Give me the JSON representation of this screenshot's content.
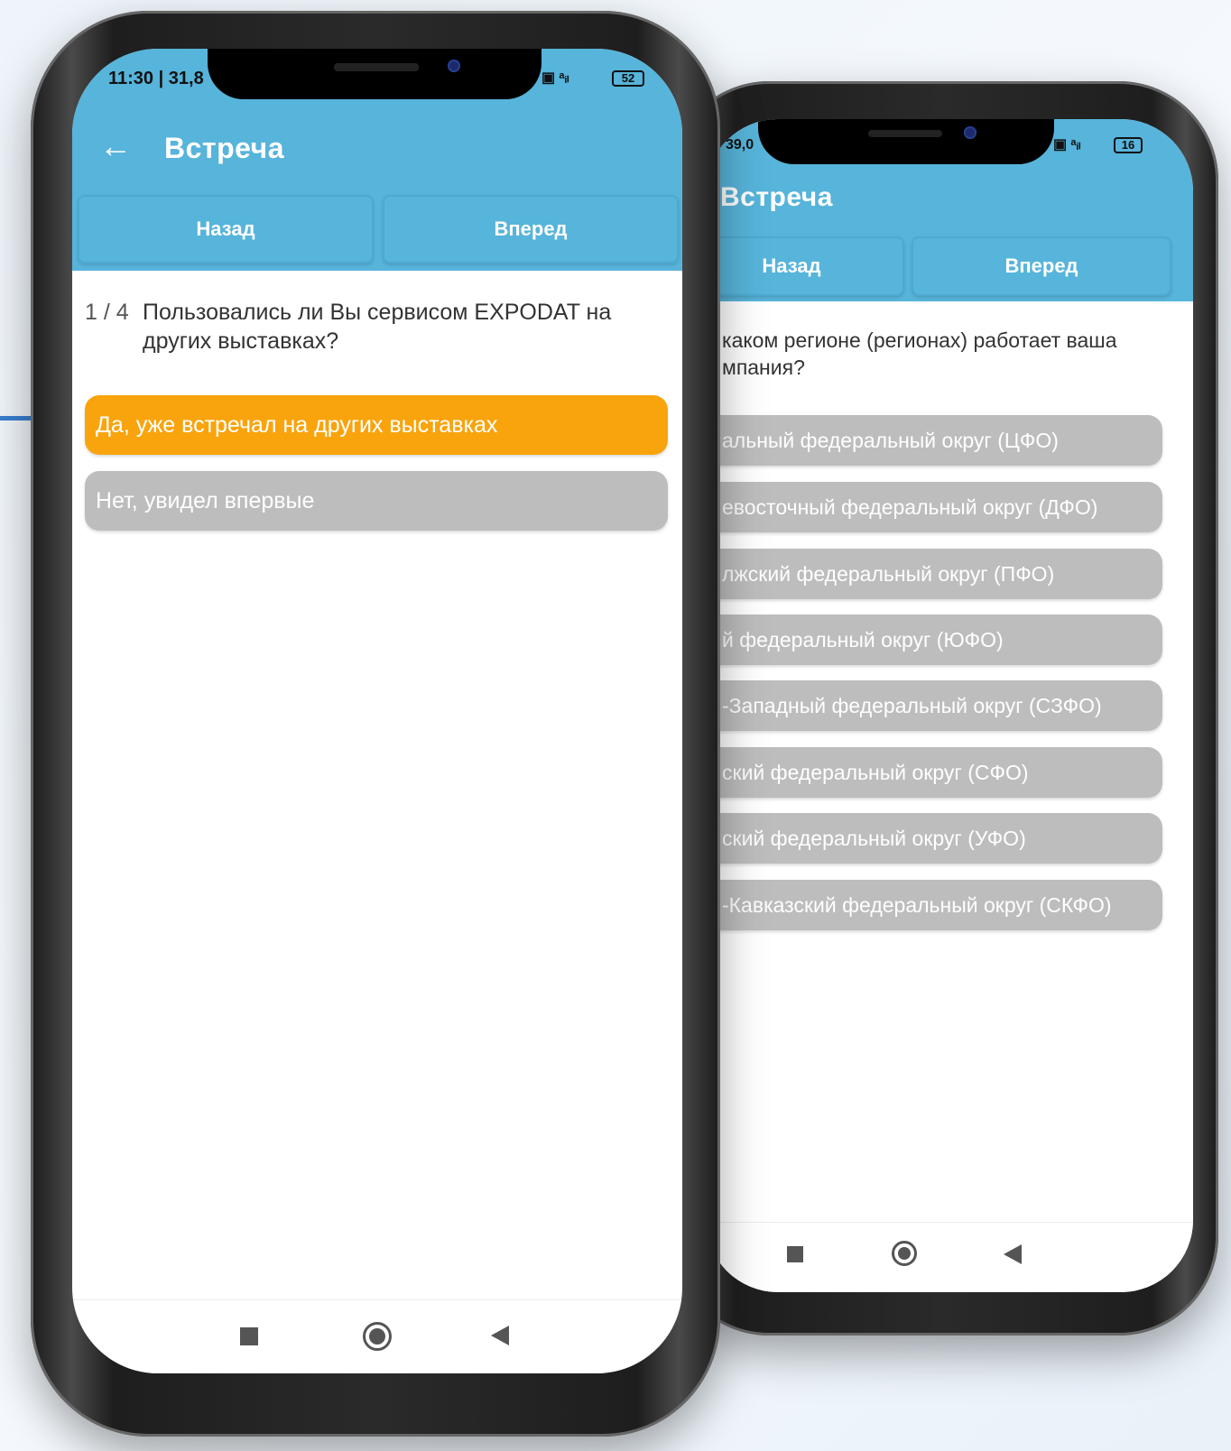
{
  "phone_left": {
    "status": {
      "time": "11:30",
      "speed": "31,8",
      "battery": "52"
    },
    "app_title": "Встреча",
    "nav": {
      "back": "Назад",
      "forward": "Вперед"
    },
    "question": {
      "counter": "1 / 4",
      "text": "Пользовались ли Вы сервисом EXPODAT на других выставках?"
    },
    "options": [
      {
        "label": "Да, уже встречал на других выставках",
        "selected": true
      },
      {
        "label": "Нет, увидел впервые",
        "selected": false
      }
    ]
  },
  "phone_right": {
    "status": {
      "speed": "39,0",
      "battery": "16"
    },
    "app_title": "Встреча",
    "nav": {
      "back": "Назад",
      "forward": "Вперед"
    },
    "question": {
      "text_line1": "каком регионе (регионах) работает ваша",
      "text_line2": "мпания?"
    },
    "options": [
      "альный федеральный округ (ЦФО)",
      "евосточный федеральный округ (ДФО)",
      "лжский федеральный округ (ПФО)",
      "й федеральный округ (ЮФО)",
      "-Западный федеральный округ (СЗФО)",
      "ский федеральный округ (СФО)",
      "ский федеральный округ (УФО)",
      "-Кавказский федеральный округ (СКФО)"
    ]
  },
  "colors": {
    "header": "#57b4da",
    "selected": "#f9a40d",
    "unselected": "#bdbdbd",
    "connector": "#3a7fd0"
  }
}
